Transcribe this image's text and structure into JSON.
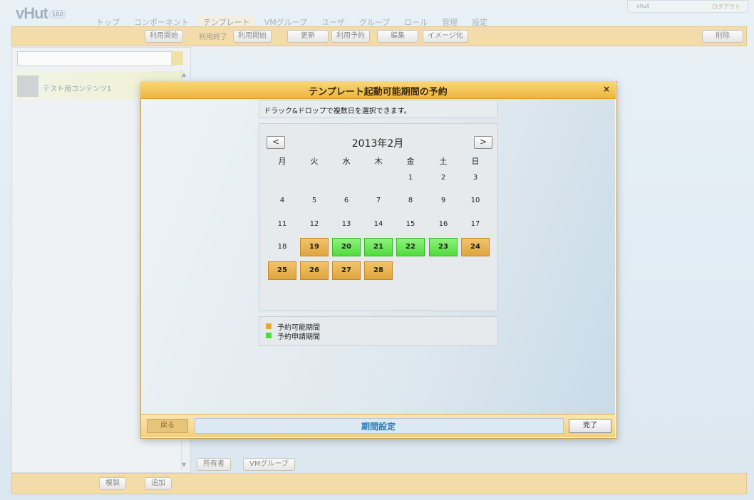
{
  "app": {
    "logo": "vHut",
    "version": "1.0.0"
  },
  "nav": {
    "tabs": [
      "トップ",
      "コンポーネント",
      "テンプレート",
      "VMグループ",
      "ユーザ",
      "グループ",
      "ロール",
      "管理",
      "設定"
    ],
    "active_index": 2
  },
  "user": {
    "name": "vhut",
    "logout": "ログアウト"
  },
  "toolbar": {
    "left_start": "利用開始",
    "usage_end": "利用終了",
    "usage_start": "利用開始",
    "update": "更新",
    "reserve": "利用予約",
    "edit": "編集",
    "imagize": "イメージ化",
    "delete": "削除"
  },
  "sidebar": {
    "search_placeholder": "",
    "items": [
      {
        "label": "テスト用コンテンツ1"
      }
    ]
  },
  "bottom": {
    "copy": "複製",
    "add": "追加",
    "owner_tab": "所有者",
    "vmgroup_tab": "VMグループ"
  },
  "dialog": {
    "title": "テンプレート起動可能期間の予約",
    "close": "×",
    "hint": "ドラック&ドロップで複数日を選択できます。",
    "calendar": {
      "month_label": "2013年2月",
      "prev": "<",
      "next": ">",
      "weekdays": [
        "月",
        "火",
        "水",
        "木",
        "金",
        "土",
        "日"
      ],
      "weeks": [
        [
          {
            "d": ""
          },
          {
            "d": ""
          },
          {
            "d": ""
          },
          {
            "d": ""
          },
          {
            "d": "1"
          },
          {
            "d": "2"
          },
          {
            "d": "3"
          }
        ],
        [
          {
            "d": "4"
          },
          {
            "d": "5"
          },
          {
            "d": "6"
          },
          {
            "d": "7"
          },
          {
            "d": "8"
          },
          {
            "d": "9"
          },
          {
            "d": "10"
          }
        ],
        [
          {
            "d": "11"
          },
          {
            "d": "12"
          },
          {
            "d": "13"
          },
          {
            "d": "14"
          },
          {
            "d": "15"
          },
          {
            "d": "16"
          },
          {
            "d": "17"
          }
        ],
        [
          {
            "d": "18"
          },
          {
            "d": "19",
            "s": "avail"
          },
          {
            "d": "20",
            "s": "req"
          },
          {
            "d": "21",
            "s": "req"
          },
          {
            "d": "22",
            "s": "req"
          },
          {
            "d": "23",
            "s": "req"
          },
          {
            "d": "24",
            "s": "avail"
          }
        ],
        [
          {
            "d": "25",
            "s": "avail"
          },
          {
            "d": "26",
            "s": "avail"
          },
          {
            "d": "27",
            "s": "avail"
          },
          {
            "d": "28",
            "s": "avail"
          },
          {
            "d": ""
          },
          {
            "d": ""
          },
          {
            "d": ""
          }
        ]
      ]
    },
    "legend": [
      {
        "label": "予約可能期間",
        "color": "#e4a83f"
      },
      {
        "label": "予約申請期間",
        "color": "#4fdc3c"
      }
    ],
    "footer": {
      "back": "戻る",
      "step": "期間設定",
      "done": "完了"
    }
  }
}
